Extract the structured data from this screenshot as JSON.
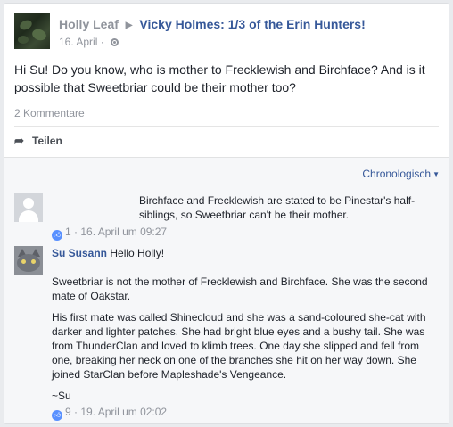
{
  "post": {
    "author": "Holly Leaf",
    "group": "Vicky Holmes: 1/3 of the Erin Hunters!",
    "date": "16. April",
    "separator": "·",
    "text": "Hi Su! Do you know, who is mother to Frecklewish and Birchface? And is it possible that Sweetbriar could be their mother too?",
    "comment_count": "2 Kommentare",
    "share_label": "Teilen",
    "icons": {
      "share": "share-arrow-icon",
      "privacy": "globe-icon",
      "group_arrow": "triangle-right-icon"
    }
  },
  "comments_section": {
    "sort_label": "Chronologisch",
    "comments": [
      {
        "author": "",
        "text": "Birchface and Frecklewish are stated to be Pinestar's half-siblings, so Sweetbriar can't be their mother.",
        "likes": "1",
        "dot": "·",
        "time": "16. April um 09:27"
      },
      {
        "author": "Su Susann",
        "greeting": "Hello Holly!",
        "paragraphs": [
          "Sweetbriar is not the mother of Frecklewish and Birchface. She was the second mate of Oakstar.",
          "His first mate was called Shinecloud and she was a sand-coloured she-cat with darker and lighter patches. She had bright blue eyes and a bushy tail. She was from ThunderClan and loved to klimb trees. One day she slipped and fell from one, breaking her neck on one of the branches she hit on her way down. She joined StarClan before Mapleshade's Vengeance.",
          "~Su"
        ],
        "likes": "9",
        "dot": "·",
        "time": "19. April um 02:02"
      }
    ]
  },
  "colors": {
    "link": "#365899",
    "meta": "#90949c",
    "text": "#1d2129",
    "like": "#5890ff"
  }
}
